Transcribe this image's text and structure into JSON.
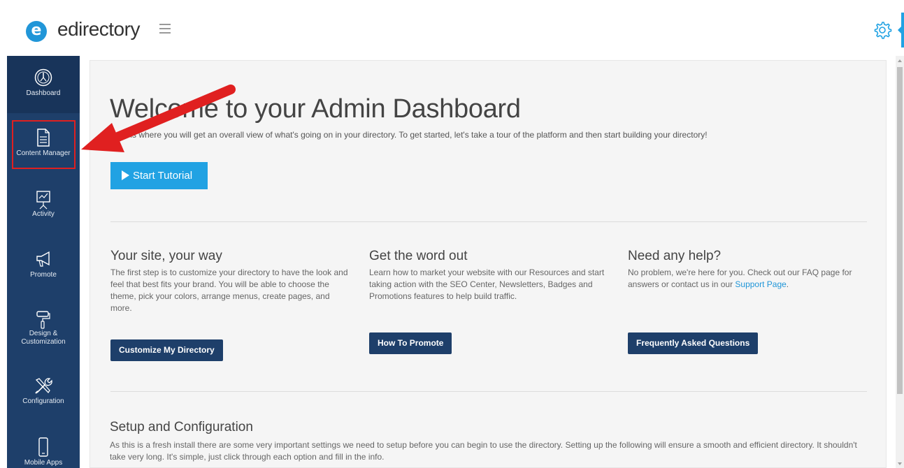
{
  "brand": {
    "logo_letter": "e",
    "name": "edirectory"
  },
  "sidebar": {
    "items": [
      {
        "label": "Dashboard",
        "icon": "dashboard-gauge-icon"
      },
      {
        "label": "Content Manager",
        "icon": "document-icon"
      },
      {
        "label": "Activity",
        "icon": "chart-board-icon"
      },
      {
        "label": "Promote",
        "icon": "megaphone-icon"
      },
      {
        "label_line1": "Design &",
        "label_line2": "Customization",
        "icon": "paint-roller-icon"
      },
      {
        "label": "Configuration",
        "icon": "tools-icon"
      },
      {
        "label": "Mobile Apps",
        "icon": "mobile-phone-icon"
      }
    ]
  },
  "main": {
    "title": "Welcome to your Admin Dashboard",
    "subtitle": "Here is where you will get an overall view of what's going on in your directory. To get started, let's take a tour of the platform and then start building your directory!",
    "tutorial_button": "Start Tutorial",
    "columns": [
      {
        "title": "Your site, your way",
        "text": "The first step is to customize your directory to have the look and feel that best fits your brand. You will be able to choose the theme, pick your colors, arrange menus, create pages, and more.",
        "button": "Customize My Directory"
      },
      {
        "title": "Get the word out",
        "text": "Learn how to market your website with our Resources and start taking action with the SEO Center, Newsletters, Badges and Promotions features to help build traffic.",
        "button": "How To Promote"
      },
      {
        "title": "Need any help?",
        "text_before_link": "No problem, we're here for you. Check out our FAQ page for answers or contact us in our ",
        "link": "Support Page",
        "text_after_link": ".",
        "button": "Frequently Asked Questions"
      }
    ],
    "setup": {
      "title": "Setup and Configuration",
      "text": "As this is a fresh install there are some very important settings we need to setup before you can begin to use the directory. Setting up the following will ensure a smooth and efficient directory. It shouldn't take very long. It's simple, just click through each option and fill in the info."
    }
  },
  "colors": {
    "sidebar": "#1e3f6a",
    "accent": "#21a2e3",
    "annotation": "#e02020"
  }
}
